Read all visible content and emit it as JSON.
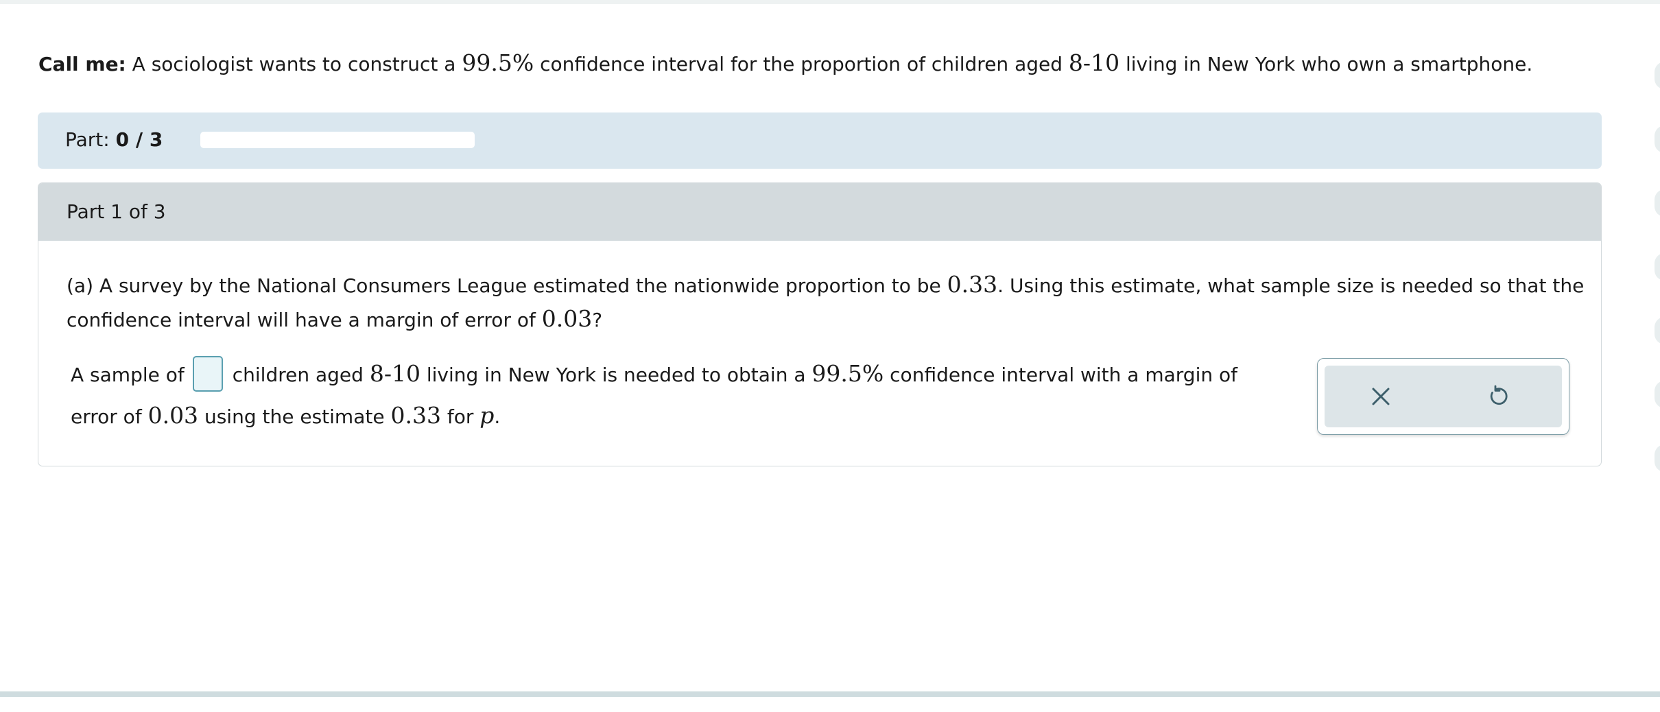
{
  "intro": {
    "lead": "Call me:",
    "t1": " A sociologist wants to construct a ",
    "m1": "99.5%",
    "t2": " confidence interval for the proportion of children aged ",
    "m2": "8-10",
    "t3": " living in New York who own a smartphone."
  },
  "progress": {
    "label": "Part: ",
    "count": "0 / 3",
    "fraction": 0
  },
  "part": {
    "header": "Part 1 of 3",
    "question": {
      "t1": "(a) A survey by the National Consumers League estimated the nationwide proportion to be ",
      "m1": "0.33",
      "t2": ". Using this estimate, what sample size is needed so that the confidence interval will have a margin of error of ",
      "m2": "0.03",
      "t3": "?"
    },
    "answer": {
      "t1": "A sample of",
      "input_value": "",
      "t2": "children aged ",
      "m1": "8-10",
      "t3": " living in New York is needed to obtain a ",
      "m2": "99.5%",
      "t4": " confidence interval with a margin of",
      "t5": "error of ",
      "m3": "0.03",
      "t6": " using the estimate ",
      "m4": "0.33",
      "t7": " for ",
      "m5": "p",
      "t8": "."
    }
  },
  "actions": {
    "clear_icon": "close-icon",
    "undo_icon": "undo-icon"
  },
  "colors": {
    "progress_panel": "#dae7ef",
    "part_header": "#d3dadd",
    "accent": "#385d6a",
    "input_border": "#5a9fb0"
  }
}
